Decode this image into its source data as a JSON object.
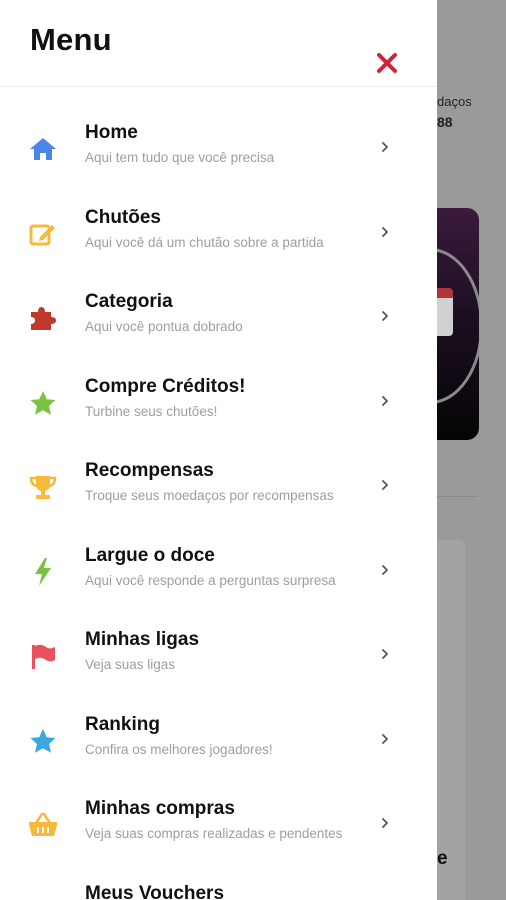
{
  "background": {
    "stat_label": "daços",
    "stat_value": "88",
    "trailing_letter": "e"
  },
  "drawer": {
    "title": "Menu",
    "close_icon": "close-icon",
    "items": [
      {
        "label": "Home",
        "subtitle": "Aqui tem tudo que você precisa",
        "icon": "home-icon",
        "color": "#4a86e8"
      },
      {
        "label": "Chutões",
        "subtitle": "Aqui você dá um chutão sobre a partida",
        "icon": "edit-icon",
        "color": "#f6b93b"
      },
      {
        "label": "Categoria",
        "subtitle": "Aqui você pontua dobrado",
        "icon": "puzzle-icon",
        "color": "#c0392b"
      },
      {
        "label": "Compre Créditos!",
        "subtitle": "Turbine seus chutões!",
        "icon": "star-icon",
        "color": "#7cc242"
      },
      {
        "label": "Recompensas",
        "subtitle": "Troque seus moedaços por recompensas",
        "icon": "trophy-icon",
        "color": "#f6b93b"
      },
      {
        "label": "Largue o doce",
        "subtitle": "Aqui você responde a perguntas surpresa",
        "icon": "bolt-icon",
        "color": "#7cc242"
      },
      {
        "label": "Minhas ligas",
        "subtitle": "Veja suas ligas",
        "icon": "flag-icon",
        "color": "#e8505b"
      },
      {
        "label": "Ranking",
        "subtitle": "Confira os melhores jogadores!",
        "icon": "star-icon",
        "color": "#3ba7e0"
      },
      {
        "label": "Minhas compras",
        "subtitle": "Veja suas compras realizadas e pendentes",
        "icon": "basket-icon",
        "color": "#f6b93b"
      },
      {
        "label": "Meus Vouchers",
        "subtitle": "",
        "icon": "voucher-icon",
        "color": "#e8505b"
      }
    ]
  }
}
